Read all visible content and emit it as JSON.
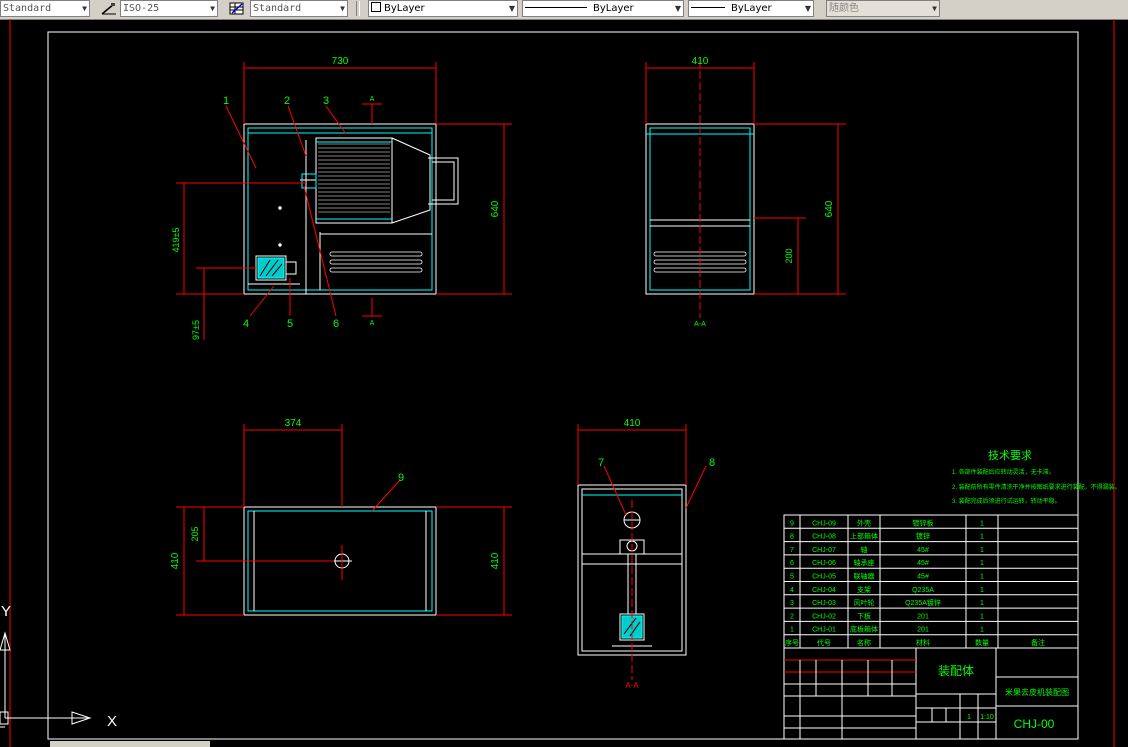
{
  "toolbar": {
    "text_style": "Standard",
    "dim_style": "ISO-25",
    "table_style": "Standard",
    "layer": "ByLayer",
    "linetype": "ByLayer",
    "lineweight": "ByLayer",
    "plot_style": "随颜色",
    "icons": [
      "dim-style-icon",
      "table-style-icon"
    ]
  },
  "drawing": {
    "front_width": "730",
    "front_height": "640",
    "dim_419": "419±5",
    "dim_97": "97±5",
    "side_width": "410",
    "side_height": "640",
    "side_200": "200",
    "side_section": "A-A",
    "section_mark": "A",
    "top_374": "374",
    "top_205": "205",
    "top_410_left": "410",
    "top_410_right": "410",
    "section_width": "410",
    "section_label": "A-A",
    "balloons": [
      "1",
      "2",
      "3",
      "4",
      "5",
      "6",
      "7",
      "8",
      "9"
    ]
  },
  "tech_req": {
    "title": "技术要求",
    "lines": [
      "1. 各部件装配后应转动灵活，无卡滞。",
      "2. 装配前所有零件清洗干净并按图纸要求进行装配，不得漏装。",
      "3. 装配完成后须进行试运转，转动平稳。"
    ]
  },
  "bom": {
    "rows": [
      [
        "9",
        "CHJ-09",
        "外壳",
        "镀锌板",
        "1"
      ],
      [
        "8",
        "CHJ-08",
        "上部箱体",
        "镀锌",
        "1"
      ],
      [
        "7",
        "CHJ-07",
        "轴",
        "45#",
        "1"
      ],
      [
        "6",
        "CHJ-06",
        "轴承座",
        "45#",
        "1"
      ],
      [
        "5",
        "CHJ-05",
        "联轴器",
        "45#",
        "1"
      ],
      [
        "4",
        "CHJ-04",
        "支架",
        "Q235A",
        "1"
      ],
      [
        "3",
        "CHJ-03",
        "风叶轮",
        "Q235A镀锌",
        "1"
      ],
      [
        "2",
        "CHJ-02",
        "下板",
        "201",
        "1"
      ],
      [
        "1",
        "CHJ-01",
        "底板箱体",
        "201",
        "1"
      ]
    ],
    "header": [
      "序号",
      "代号",
      "名称",
      "材料",
      "数量",
      "备注"
    ]
  },
  "title_block": {
    "assembly": "装配体",
    "title": "米果去皮机装配图",
    "code": "CHJ-00",
    "scale": "1:10",
    "qty": "1"
  },
  "ucs": {
    "x_label": "X",
    "y_label": "Y"
  }
}
